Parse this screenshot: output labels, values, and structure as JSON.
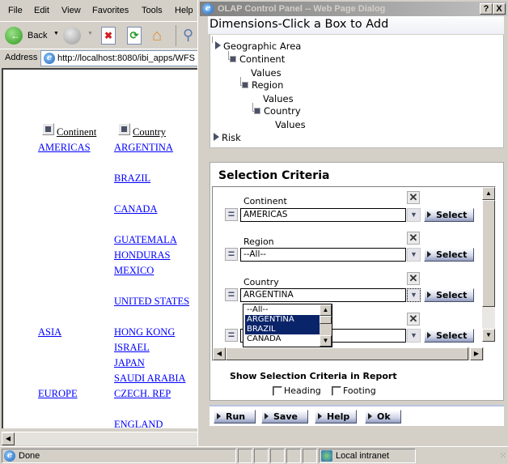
{
  "browser": {
    "menu": [
      "File",
      "Edit",
      "View",
      "Favorites",
      "Tools",
      "Help"
    ],
    "toolbar": {
      "back_label": "Back"
    },
    "address": {
      "label": "Address",
      "url": "http://localhost:8080/ibi_apps/WFS"
    },
    "status": {
      "text": "Done",
      "zone": "Local intranet"
    }
  },
  "report": {
    "headers": {
      "continent": "Continent",
      "country": "Country"
    },
    "continents": [
      "AMERICAS",
      "ASIA",
      "EUROPE"
    ],
    "countries": [
      "ARGENTINA",
      "BRAZIL",
      "CANADA",
      "GUATEMALA",
      "HONDURAS",
      "MEXICO",
      "UNITED STATES",
      "HONG KONG",
      "ISRAEL",
      "JAPAN",
      "SAUDI ARABIA",
      "CZECH. REP",
      "ENGLAND"
    ]
  },
  "dialog": {
    "title": "OLAP Control Panel -- Web Page Dialog",
    "help_btn": "?",
    "close_btn": "X",
    "dimensions": {
      "header": "Dimensions-Click a Box to Add",
      "tree": {
        "geo": "Geographic Area",
        "continent": "Continent",
        "continent_values": "Values",
        "region": "Region",
        "region_values": "Values",
        "country": "Country",
        "country_values": "Values",
        "risk": "Risk"
      }
    },
    "selection": {
      "title": "Selection Criteria",
      "criteria": [
        {
          "label": "Continent",
          "value": "AMERICAS",
          "button": "Select"
        },
        {
          "label": "Region",
          "value": "--All--",
          "button": "Select"
        },
        {
          "label": "Country",
          "value": "ARGENTINA",
          "button": "Select"
        },
        {
          "label": "",
          "value": "",
          "button": "Select"
        }
      ],
      "dropdown_options": [
        {
          "label": "--All--",
          "selected": false
        },
        {
          "label": "ARGENTINA",
          "selected": true
        },
        {
          "label": "BRAZIL",
          "selected": true
        },
        {
          "label": "CANADA",
          "selected": false
        }
      ],
      "show_in_report": "Show Selection Criteria in Report",
      "heading_label": "Heading",
      "heading_checked": false,
      "footing_label": "Footing",
      "footing_checked": false
    },
    "buttons": {
      "run": "Run",
      "save": "Save",
      "help": "Help",
      "ok": "Ok"
    }
  }
}
